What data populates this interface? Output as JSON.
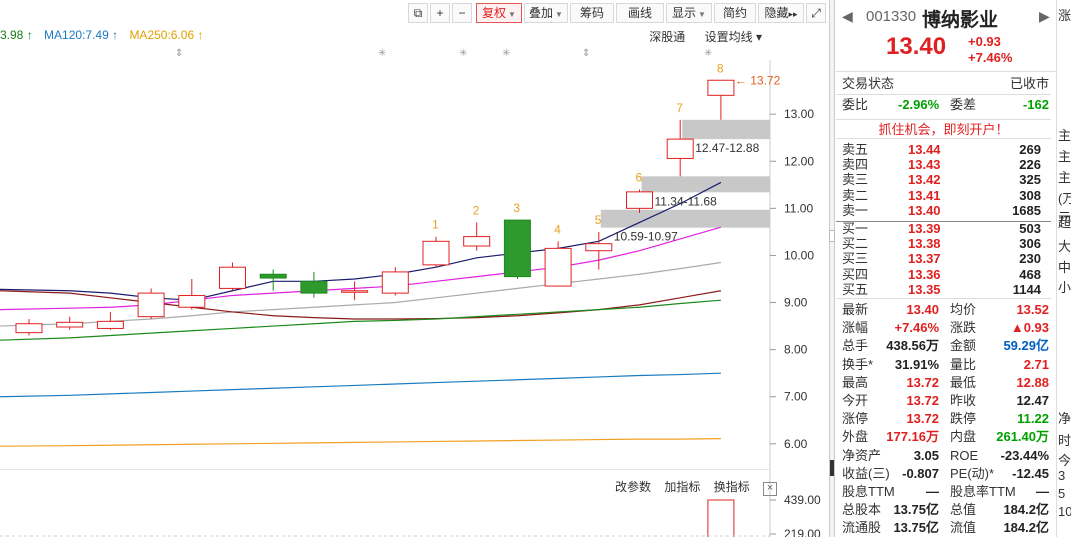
{
  "toolbar": {
    "btn_minimize": "−",
    "btn_add": "+",
    "fuquan": "复权",
    "diejia": "叠加",
    "chouma": "筹码",
    "huaxian": "画线",
    "xianshi": "显示",
    "jianyue": "简约",
    "yincang": "隐藏",
    "yincang_arrows": "▸▸",
    "fullscreen_icon": "expand-icon"
  },
  "ma_legend": {
    "partial": "3.98 ↑",
    "ma120": "MA120:7.49 ↑",
    "ma250": "MA250:6.06 ↑"
  },
  "chart_links": {
    "depth": "深股通",
    "settings": "设置均线 ▾"
  },
  "sub_toolbar": {
    "params": "改参数",
    "add_indicator": "加指标",
    "switch_indicator": "换指标",
    "close": "×"
  },
  "chart_data": {
    "type": "candlestick",
    "y_ticks": [
      "13.00",
      "12.00",
      "11.00",
      "10.00",
      "9.00",
      "8.00",
      "7.00",
      "6.00"
    ],
    "ylim": [
      5.55,
      14.15
    ],
    "volume_ticks": [
      "439.00",
      "219.00"
    ],
    "candles": [
      {
        "o": 8.36,
        "c": 8.55,
        "h": 8.65,
        "l": 8.3
      },
      {
        "o": 8.48,
        "c": 8.58,
        "h": 8.7,
        "l": 8.42
      },
      {
        "o": 8.45,
        "c": 8.6,
        "h": 8.8,
        "l": 8.42
      },
      {
        "o": 8.7,
        "c": 9.2,
        "h": 9.3,
        "l": 8.65
      },
      {
        "o": 8.9,
        "c": 9.15,
        "h": 9.5,
        "l": 8.85
      },
      {
        "o": 9.3,
        "c": 9.75,
        "h": 9.85,
        "l": 9.25
      },
      {
        "o": 9.6,
        "c": 9.52,
        "h": 9.7,
        "l": 9.25
      },
      {
        "o": 9.45,
        "c": 9.2,
        "h": 9.65,
        "l": 9.1
      },
      {
        "o": 9.22,
        "c": 9.25,
        "h": 9.45,
        "l": 9.05
      },
      {
        "o": 9.2,
        "c": 9.65,
        "h": 9.75,
        "l": 9.15
      },
      {
        "o": 9.8,
        "c": 10.3,
        "h": 10.4,
        "l": 9.75
      },
      {
        "o": 10.2,
        "c": 10.4,
        "h": 10.7,
        "l": 10.1
      },
      {
        "o": 10.75,
        "c": 9.55,
        "h": 10.75,
        "l": 9.5
      },
      {
        "o": 9.35,
        "c": 10.15,
        "h": 10.3,
        "l": 9.35
      },
      {
        "o": 10.1,
        "c": 10.25,
        "h": 10.5,
        "l": 9.7
      },
      {
        "o": 11.0,
        "c": 11.35,
        "h": 11.4,
        "l": 10.9
      },
      {
        "o": 12.06,
        "c": 12.47,
        "h": 12.88,
        "l": 11.68
      },
      {
        "o": 13.4,
        "c": 13.72,
        "h": 13.72,
        "l": 12.88
      }
    ],
    "candle_labels": [
      {
        "i": 10,
        "t": "1"
      },
      {
        "i": 11,
        "t": "2"
      },
      {
        "i": 12,
        "t": "3"
      },
      {
        "i": 13,
        "t": "4"
      },
      {
        "i": 14,
        "t": "5"
      },
      {
        "i": 15,
        "t": "6"
      },
      {
        "i": 16,
        "t": "7"
      },
      {
        "i": 17,
        "t": "8"
      }
    ],
    "gaps": [
      {
        "range": [
          10.59,
          10.97
        ],
        "label": "10.59-10.97",
        "from": 14
      },
      {
        "range": [
          11.34,
          11.68
        ],
        "label": "11.34-11.68",
        "from": 15
      },
      {
        "range": [
          12.47,
          12.88
        ],
        "label": "12.47-12.88",
        "from": 16
      }
    ],
    "high_label": "← 13.72",
    "high_value": 13.72,
    "ma_lines": [
      {
        "color": "#1a1a6e",
        "values": [
          9.28,
          9.25,
          9.2,
          9.1,
          9.05,
          9.25,
          9.45,
          9.45,
          9.5,
          9.6,
          9.75,
          9.95,
          10.05,
          10.15,
          10.3,
          10.7,
          11.1,
          11.55
        ]
      },
      {
        "color": "#e020e0",
        "values": [
          8.85,
          8.88,
          8.9,
          8.95,
          9.05,
          9.15,
          9.2,
          9.25,
          9.3,
          9.35,
          9.45,
          9.55,
          9.65,
          9.75,
          9.9,
          10.1,
          10.35,
          10.6
        ]
      },
      {
        "color": "#aaaaaa",
        "values": [
          8.5,
          8.55,
          8.6,
          8.65,
          8.72,
          8.8,
          8.85,
          8.9,
          8.95,
          9.0,
          9.1,
          9.2,
          9.3,
          9.4,
          9.5,
          9.6,
          9.72,
          9.85
        ]
      },
      {
        "color": "#8b1a1a",
        "values": [
          9.25,
          9.2,
          9.1,
          9.0,
          8.9,
          8.8,
          8.72,
          8.68,
          8.65,
          8.65,
          8.66,
          8.68,
          8.72,
          8.78,
          8.85,
          8.95,
          9.1,
          9.25
        ]
      },
      {
        "color": "#1a8a1a",
        "values": [
          8.2,
          8.25,
          8.3,
          8.35,
          8.4,
          8.45,
          8.5,
          8.55,
          8.6,
          8.62,
          8.65,
          8.7,
          8.75,
          8.8,
          8.85,
          8.9,
          8.98,
          9.05
        ]
      },
      {
        "color": "#1a7ac0",
        "values": [
          7.0,
          7.03,
          7.06,
          7.09,
          7.12,
          7.15,
          7.18,
          7.21,
          7.24,
          7.27,
          7.3,
          7.33,
          7.36,
          7.39,
          7.42,
          7.45,
          7.47,
          7.5
        ]
      },
      {
        "color": "#f0a020",
        "values": [
          5.95,
          5.96,
          5.97,
          5.98,
          5.99,
          6.0,
          6.01,
          6.02,
          6.03,
          6.04,
          6.05,
          6.06,
          6.07,
          6.08,
          6.09,
          6.1,
          6.1,
          6.11
        ]
      }
    ]
  },
  "quote": {
    "prev": "◀",
    "next": "▶",
    "code": "001330",
    "name": "博纳影业",
    "price": "13.40",
    "change": "+0.93",
    "change_pct": "+7.46%",
    "status_label": "交易状态",
    "status_value": "已收市",
    "weibi_label": "委比",
    "weibi_value": "-2.96%",
    "weicha_label": "委差",
    "weicha_value": "-162",
    "open_account": "抓住机会，即刻开户！",
    "asks": [
      {
        "label": "卖五",
        "price": "13.44",
        "vol": "269"
      },
      {
        "label": "卖四",
        "price": "13.43",
        "vol": "226"
      },
      {
        "label": "卖三",
        "price": "13.42",
        "vol": "325"
      },
      {
        "label": "卖二",
        "price": "13.41",
        "vol": "308"
      },
      {
        "label": "卖一",
        "price": "13.40",
        "vol": "1685"
      }
    ],
    "bids": [
      {
        "label": "买一",
        "price": "13.39",
        "vol": "503"
      },
      {
        "label": "买二",
        "price": "13.38",
        "vol": "306"
      },
      {
        "label": "买三",
        "price": "13.37",
        "vol": "230"
      },
      {
        "label": "买四",
        "price": "13.36",
        "vol": "468"
      },
      {
        "label": "买五",
        "price": "13.35",
        "vol": "1144"
      }
    ],
    "stats": [
      {
        "l1": "最新",
        "v1": "13.40",
        "c1": "red",
        "l2": "均价",
        "v2": "13.52",
        "c2": "red"
      },
      {
        "l1": "涨幅",
        "v1": "+7.46%",
        "c1": "red",
        "l2": "涨跌",
        "v2": "▲0.93",
        "c2": "red"
      },
      {
        "l1": "总手",
        "v1": "438.56万",
        "c1": "dark",
        "l2": "金额",
        "v2": "59.29亿",
        "c2": "blue"
      },
      {
        "l1": "换手*",
        "v1": "31.91%",
        "c1": "dark",
        "l2": "量比",
        "v2": "2.71",
        "c2": "red"
      },
      {
        "l1": "最高",
        "v1": "13.72",
        "c1": "red",
        "l2": "最低",
        "v2": "12.88",
        "c2": "red"
      },
      {
        "l1": "今开",
        "v1": "13.72",
        "c1": "red",
        "l2": "昨收",
        "v2": "12.47",
        "c2": "dark"
      },
      {
        "l1": "涨停",
        "v1": "13.72",
        "c1": "red",
        "l2": "跌停",
        "v2": "11.22",
        "c2": "green"
      },
      {
        "l1": "外盘",
        "v1": "177.16万",
        "c1": "red",
        "l2": "内盘",
        "v2": "261.40万",
        "c2": "green"
      },
      {
        "l1": "净资产",
        "v1": "3.05",
        "c1": "dark",
        "l2": "ROE",
        "v2": "-23.44%",
        "c2": "dark"
      },
      {
        "l1": "收益(三)",
        "v1": "-0.807",
        "c1": "dark",
        "l2": "PE(动)*",
        "v2": "-12.45",
        "c2": "dark"
      },
      {
        "l1": "股息TTM",
        "v1": "—",
        "c1": "dark",
        "l2": "股息率TTM",
        "v2": "—",
        "c2": "dark"
      },
      {
        "l1": "总股本",
        "v1": "13.75亿",
        "c1": "dark",
        "l2": "总值",
        "v2": "184.2亿",
        "c2": "dark"
      },
      {
        "l1": "流通股",
        "v1": "13.75亿",
        "c1": "dark",
        "l2": "流值",
        "v2": "184.2亿",
        "c2": "dark"
      }
    ]
  },
  "far_right": [
    "涨",
    "主",
    "主",
    "主",
    "(万元",
    "超",
    "大",
    "中",
    "小",
    "净",
    "时",
    "今",
    "3",
    "5",
    "10"
  ]
}
